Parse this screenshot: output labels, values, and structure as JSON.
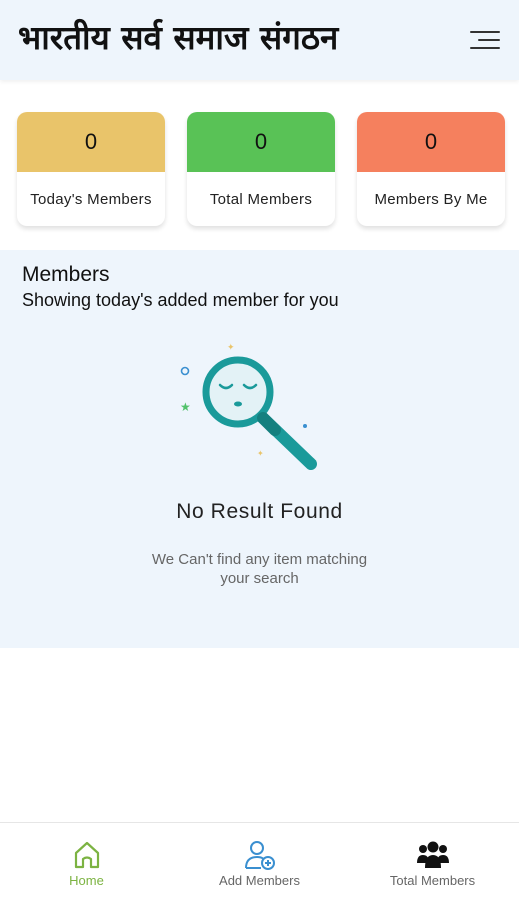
{
  "header": {
    "title": "भारतीय सर्व समाज संगठन",
    "menu_icon": "hamburger-icon"
  },
  "stats": [
    {
      "value": "0",
      "label": "Today's Members",
      "color": "#e9c46a"
    },
    {
      "value": "0",
      "label": "Total Members",
      "color": "#59c256"
    },
    {
      "value": "0",
      "label": "Members By Me",
      "color": "#f5805e"
    }
  ],
  "members": {
    "title": "Members",
    "subtitle": "Showing today's added member for you",
    "empty_title": "No Result Found",
    "empty_line1": "We Can't find any item matching",
    "empty_line2": "your search",
    "illustration_icon": "magnifier-sad-face-icon",
    "accent": "#1a9a9a"
  },
  "nav": {
    "active_color": "#7cb342",
    "items": [
      {
        "label": "Home",
        "icon": "home-icon",
        "active": true
      },
      {
        "label": "Add Members",
        "icon": "add-user-icon",
        "active": false
      },
      {
        "label": "Total Members",
        "icon": "group-icon",
        "active": false
      }
    ]
  }
}
